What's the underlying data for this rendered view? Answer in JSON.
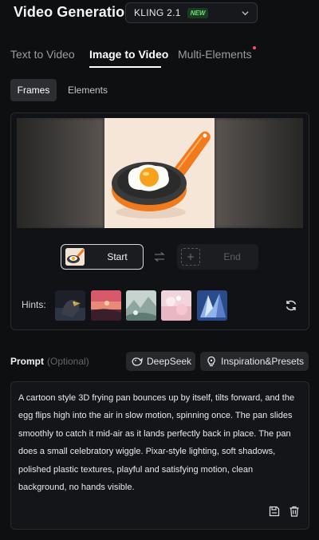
{
  "header": {
    "title": "Video Generation",
    "model": "KLING 2.1",
    "model_badge": "NEW"
  },
  "mode_tabs": [
    {
      "label": "Text to Video",
      "active": false
    },
    {
      "label": "Image to Video",
      "active": true
    },
    {
      "label": "Multi-Elements",
      "active": false,
      "has_notification_dot": true
    }
  ],
  "sub_tabs": [
    {
      "label": "Frames",
      "active": true
    },
    {
      "label": "Elements",
      "active": false
    }
  ],
  "frames": {
    "start_label": "Start",
    "end_label": "End",
    "hints_label": "Hints:"
  },
  "prompt": {
    "title": "Prompt",
    "optional_label": "(Optional)",
    "deepseek_label": "DeepSeek",
    "inspiration_label": "Inspiration&Presets",
    "text": "A cartoon style 3D frying pan bounces up by itself, tilts forward, and the egg flips high into the air in slow motion, spinning once. The pan slides smoothly to catch it mid-air as it lands perfectly back in place. The pan does a small celebratory wiggle. Pixar-style lighting, soft shadows, polished plastic textures, playful and satisfying motion, clean background, no hands visible."
  },
  "icons": {
    "model_dropdown": "chevron-down-icon",
    "swap": "swap-icon",
    "refresh": "refresh-icon",
    "deepseek": "deepseek-whale-icon",
    "inspiration": "bulb-icon",
    "save": "save-icon",
    "delete": "trash-icon"
  },
  "colors": {
    "background": "#0e0f11",
    "new_badge": "#6fe07a",
    "notification_dot": "#ff4d4f",
    "pan_handle": "#f07a1c"
  }
}
